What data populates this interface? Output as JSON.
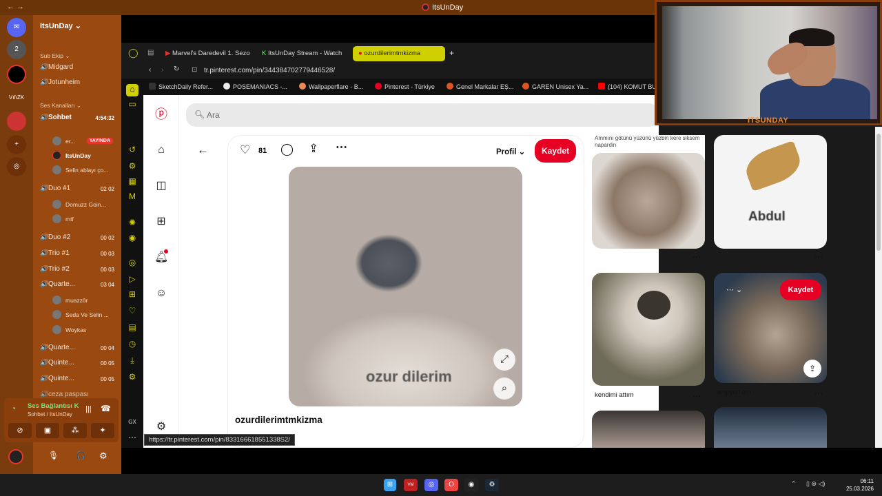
{
  "titlebar": {
    "title": "ItsUnDay",
    "nav": "← →"
  },
  "discord": {
    "server_name": "ItsUnDay",
    "rail": [
      "",
      "2",
      "",
      "VıfıZK",
      "",
      "+",
      ""
    ],
    "sections": {
      "sub_ekip": "Sub Ekip",
      "ses_kanallari": "Ses Kanalları"
    },
    "text_channels": [
      "Midgard",
      "Jotunheim"
    ],
    "voice_channels": [
      {
        "name": "Sohbet",
        "count": "4:54:32"
      },
      {
        "name": "Duo #1",
        "count": "02  02"
      },
      {
        "name": "Duo #2",
        "count": "00  02"
      },
      {
        "name": "Trio #1",
        "count": "00  03"
      },
      {
        "name": "Trio #2",
        "count": "00  03"
      },
      {
        "name": "Quarte...",
        "count": "03  04"
      },
      {
        "name": "Quarte...",
        "count": "00  04"
      },
      {
        "name": "Quinte...",
        "count": "00  05"
      },
      {
        "name": "Quinte...",
        "count": "00  05"
      },
      {
        "name": "ceza paspası",
        "count": ""
      }
    ],
    "sohbet_users": [
      "er...",
      "ItsUnDay",
      "Selin ablayı ço..."
    ],
    "live_badge": "YAYINDA",
    "duo1_users": [
      "Domuzz Goin...",
      "mtf"
    ],
    "quartet_users": [
      "muazzôr",
      "Seda Ve Selin ...",
      "Woykas"
    ],
    "voice_status": {
      "title": "Ses Bağlantısı K",
      "subtitle": "Sohbet / ItsUnDay"
    }
  },
  "browser": {
    "tabs": [
      {
        "label": "Marvel's Daredevil 1. Sezo"
      },
      {
        "label": "ItsUnDay Stream - Watch"
      },
      {
        "label": "ozurdilerimtmkizma"
      }
    ],
    "url": "tr.pinterest.com/pin/344384702779446528/",
    "bookmarks": [
      "SketchDaily Refer...",
      "POSEMANIACS -...",
      "Wallpaperflare - B...",
      "Pinterest - Türkiye",
      "Genel Markalar EŞ...",
      "GAREN Unisex Ya...",
      "(104) KOMUT BU"
    ],
    "status_url": "https://tr.pinterest.com/pin/833166618551338S2/"
  },
  "pinterest": {
    "search_placeholder": "Ara",
    "likes": "81",
    "profile_label": "Profil",
    "save_label": "Kaydet",
    "pin_title": "ozurdilerimtmkizma",
    "pin_caption": "ozur dilerim",
    "grid": [
      {
        "overlay": "Ammını götünü yüzünü yüzbin kere siksem napardin",
        "label": ""
      },
      {
        "overlay": "Abdul",
        "label": ""
      },
      {
        "overlay": "",
        "label": "kendimi attım"
      },
      {
        "overlay": "",
        "label": "ampyun om",
        "save": "Kaydet"
      }
    ]
  },
  "webcam": {
    "name": "ITSUNDAY"
  },
  "taskbar": {
    "time": "06:11",
    "date": "25.03.2026"
  },
  "colors": {
    "pinterest_red": "#e60023",
    "discord_orange": "#9a4a10",
    "opera_yellow": "#d0d000"
  }
}
